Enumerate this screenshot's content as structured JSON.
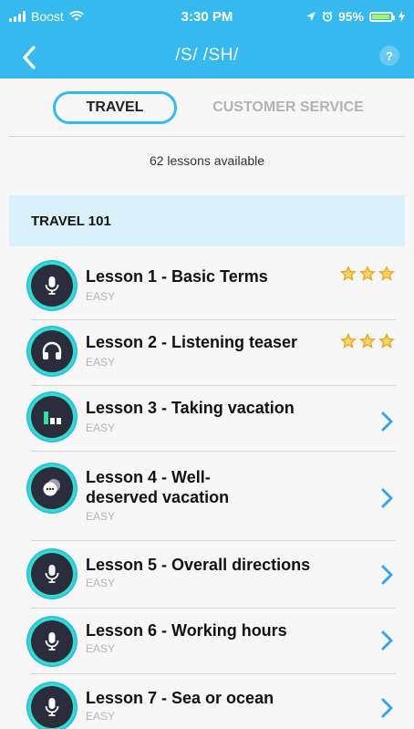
{
  "status_bar": {
    "carrier": "Boost",
    "time": "3:30 PM",
    "battery": "95%",
    "battery_level": 0.95
  },
  "nav": {
    "title": "/S/ /SH/",
    "back_icon": "chevron-left-icon",
    "help_icon": "question-icon"
  },
  "tabs": [
    {
      "label": "TRAVEL",
      "active": true
    },
    {
      "label": "CUSTOMER SERVICE",
      "active": false
    }
  ],
  "lessons_available": "62 lessons available",
  "section": {
    "title": "TRAVEL 101"
  },
  "lessons": [
    {
      "title": "Lesson 1 - Basic Terms",
      "level": "EASY",
      "icon": "microphone-icon",
      "stars": 3
    },
    {
      "title": "Lesson 2 - Listening teaser",
      "level": "EASY",
      "icon": "headphones-icon",
      "stars": 3
    },
    {
      "title": "Lesson 3 - Taking vacation",
      "level": "EASY",
      "icon": "bars-icon",
      "stars": 0
    },
    {
      "title": "Lesson 4 - Well-deserved vacation",
      "level": "EASY",
      "icon": "chat-icon",
      "stars": 0
    },
    {
      "title": "Lesson 5 - Overall directions",
      "level": "EASY",
      "icon": "microphone-icon",
      "stars": 0
    },
    {
      "title": "Lesson 6 - Working hours",
      "level": "EASY",
      "icon": "microphone-icon",
      "stars": 0
    },
    {
      "title": "Lesson 7 - Sea or ocean",
      "level": "EASY",
      "icon": "microphone-icon",
      "stars": 0
    }
  ],
  "colors": {
    "header": "#35b9ee",
    "section_bg": "#d8f1fb",
    "icon_ring": "#2fe0c8",
    "star": "#e8a92b",
    "chevron": "#35a5e8"
  }
}
